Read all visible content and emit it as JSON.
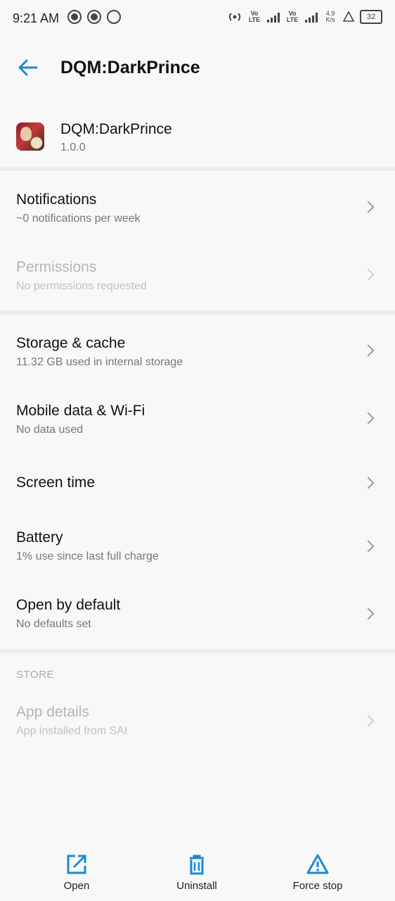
{
  "status_bar": {
    "time": "9:21 AM",
    "vo_lte_1": "Vo LTE",
    "vo_lte_2": "Vo LTE",
    "speed": "4.9 K/s",
    "battery": "32"
  },
  "app_bar": {
    "title": "DQM:DarkPrince"
  },
  "app_header": {
    "name": "DQM:DarkPrince",
    "version": "1.0.0"
  },
  "items": [
    {
      "title": "Notifications",
      "subtitle": "~0 notifications per week",
      "enabled": true
    },
    {
      "title": "Permissions",
      "subtitle": "No permissions requested",
      "enabled": false
    },
    {
      "title": "Storage & cache",
      "subtitle": "11.32 GB used in internal storage",
      "enabled": true
    },
    {
      "title": "Mobile data & Wi-Fi",
      "subtitle": "No data used",
      "enabled": true
    },
    {
      "title": "Screen time",
      "subtitle": "",
      "enabled": true
    },
    {
      "title": "Battery",
      "subtitle": "1% use since last full charge",
      "enabled": true
    },
    {
      "title": "Open by default",
      "subtitle": "No defaults set",
      "enabled": true
    },
    {
      "title": "App details",
      "subtitle": "App installed from SAI",
      "enabled": false
    }
  ],
  "store_section_label": "STORE",
  "bottom_actions": {
    "open": "Open",
    "uninstall": "Uninstall",
    "force_stop": "Force stop"
  },
  "colors": {
    "accent": "#1a8ad8",
    "background": "#f8f8f8",
    "divider": "#ececec"
  }
}
